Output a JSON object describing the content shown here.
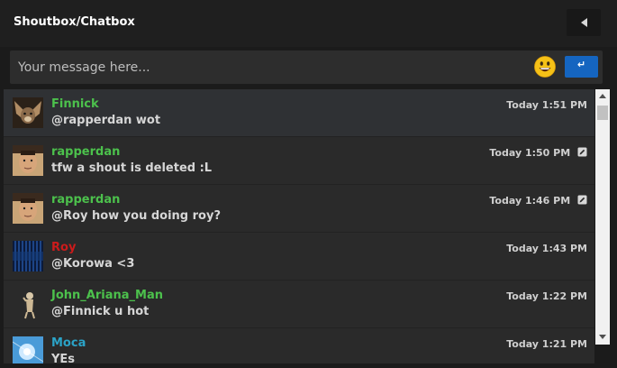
{
  "header": {
    "title": "Shoutbox/Chatbox",
    "collapse_icon": "caret-left-icon"
  },
  "composer": {
    "placeholder": "Your message here...",
    "emoji_icon": "smiley-icon",
    "send_icon": "enter-arrow-icon",
    "send_symbol": "↵"
  },
  "colors": {
    "green_user": "#4cc14c",
    "red_user": "#cc1b1b",
    "teal_user": "#2ba3c7",
    "send_button": "#1565c0"
  },
  "messages": [
    {
      "author": "Finnick",
      "color": "#4cc14c",
      "text": "@rapperdan wot",
      "time": "Today 1:51 PM",
      "edited": false
    },
    {
      "author": "rapperdan",
      "color": "#4cc14c",
      "text": "tfw a shout is deleted :L",
      "time": "Today 1:50 PM",
      "edited": true
    },
    {
      "author": "rapperdan",
      "color": "#4cc14c",
      "text": "@Roy how you doing roy?",
      "time": "Today 1:46 PM",
      "edited": true
    },
    {
      "author": "Roy",
      "color": "#cc1b1b",
      "text": "@Korowa <3",
      "time": "Today 1:43 PM",
      "edited": false
    },
    {
      "author": "John_Ariana_Man",
      "color": "#4cc14c",
      "text": "@Finnick u hot",
      "time": "Today 1:22 PM",
      "edited": false
    },
    {
      "author": "Moca",
      "color": "#2ba3c7",
      "text": "YEs",
      "time": "Today 1:21 PM",
      "edited": false
    }
  ]
}
